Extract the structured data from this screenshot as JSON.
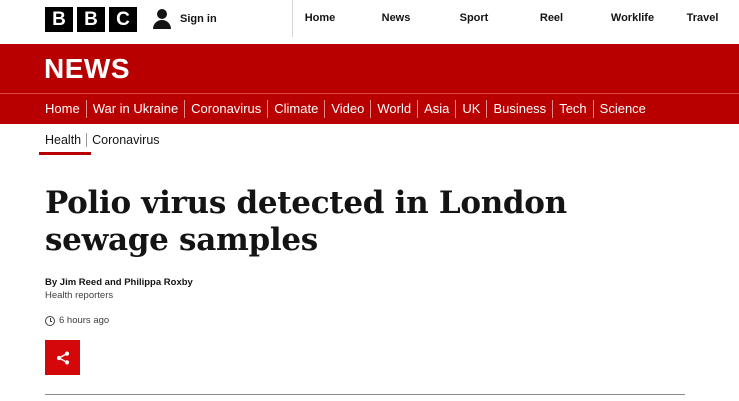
{
  "brand": {
    "letters": [
      "B",
      "B",
      "C"
    ]
  },
  "account": {
    "signin_label": "Sign in"
  },
  "topnav": {
    "items": [
      {
        "label": "Home"
      },
      {
        "label": "News"
      },
      {
        "label": "Sport"
      },
      {
        "label": "Reel"
      },
      {
        "label": "Worklife"
      },
      {
        "label": "Travel"
      }
    ]
  },
  "banner": {
    "title": "NEWS"
  },
  "section_nav": {
    "items": [
      {
        "label": "Home"
      },
      {
        "label": "War in Ukraine"
      },
      {
        "label": "Coronavirus"
      },
      {
        "label": "Climate"
      },
      {
        "label": "Video"
      },
      {
        "label": "World"
      },
      {
        "label": "Asia"
      },
      {
        "label": "UK"
      },
      {
        "label": "Business"
      },
      {
        "label": "Tech"
      },
      {
        "label": "Science"
      }
    ]
  },
  "subnav": {
    "items": [
      {
        "label": "Health",
        "active": true
      },
      {
        "label": "Coronavirus",
        "active": false
      }
    ]
  },
  "article": {
    "headline": "Polio virus detected in London sewage samples",
    "byline": "By Jim Reed and Philippa Roxby",
    "role": "Health reporters",
    "timestamp": "6 hours ago"
  },
  "colors": {
    "brand_red": "#b80000",
    "share_red": "#d4080b",
    "text": "#141414"
  },
  "icons": {
    "account": "user-icon",
    "time": "clock-icon",
    "share": "share-icon"
  }
}
